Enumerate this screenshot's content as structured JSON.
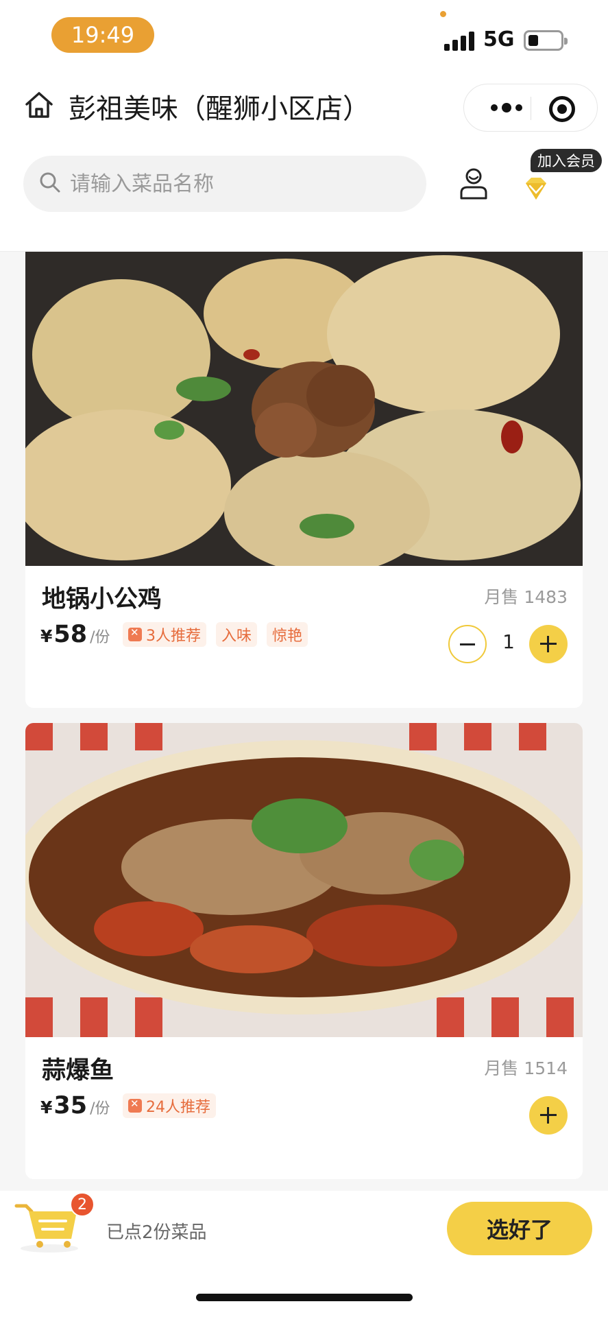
{
  "status_bar": {
    "time": "19:49",
    "network": "5G",
    "icons": [
      "signal-icon",
      "battery-icon"
    ]
  },
  "header": {
    "title": "彭祖美味（醒狮小区店）",
    "icons": [
      "home-icon",
      "more-icon",
      "target-icon"
    ]
  },
  "search": {
    "placeholder": "请输入菜品名称",
    "value": ""
  },
  "member": {
    "badge": "加入会员",
    "icons": [
      "user-icon",
      "diamond-icon"
    ]
  },
  "dishes": [
    {
      "name": "地锅小公鸡",
      "monthly_sales_label": "月售 1483",
      "currency": "¥",
      "price": "58",
      "unit": "/份",
      "tags": [
        "3人推荐",
        "入味",
        "惊艳"
      ],
      "quantity": "1",
      "image_icon": "dish-photo-chicken"
    },
    {
      "name": "蒜爆鱼",
      "monthly_sales_label": "月售 1514",
      "currency": "¥",
      "price": "35",
      "unit": "/份",
      "tags": [
        "24人推荐"
      ],
      "image_icon": "dish-photo-fish"
    }
  ],
  "cart": {
    "count": "2",
    "summary": "已点2份菜品",
    "checkout_label": "选好了",
    "icon": "cart-icon"
  },
  "colors": {
    "accent": "#f4cf47",
    "brand_orange": "#e9a033",
    "tag_text": "#e66c3c",
    "tag_bg": "#fdf1ea"
  }
}
